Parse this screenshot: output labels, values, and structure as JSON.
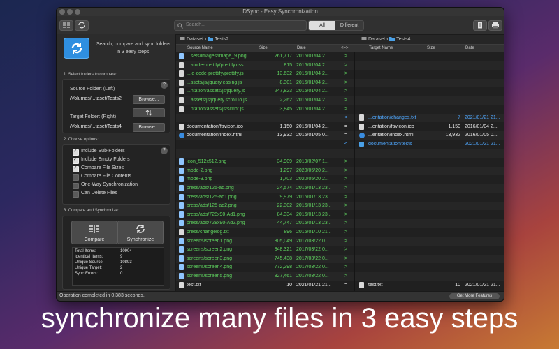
{
  "window": {
    "title": "DSync - Easy Synchronization"
  },
  "toolbar": {
    "search_placeholder": "Search...",
    "filter_options": [
      "All",
      "Different"
    ],
    "filter_selected": "All"
  },
  "left_panel": {
    "tagline": "Search, compare and sync folders in 3 easy steps:",
    "step1": {
      "title": "1. Select folders to compare:",
      "source_label": "Source Folder: (Left)",
      "source_path": "/Volumes/...taset/Tests2",
      "browse_label": "Browse...",
      "target_label": "Target Folder: (Right)",
      "target_path": "/Volumes/...taset/Tests4"
    },
    "step2": {
      "title": "2. Choose options:",
      "options": [
        {
          "label": "Include Sub-Folders",
          "checked": true
        },
        {
          "label": "Include Empty Folders",
          "checked": true
        },
        {
          "label": "Compare File Sizes",
          "checked": true
        },
        {
          "label": "Compare File Contents",
          "checked": false
        },
        {
          "label": "One-Way Synchronization",
          "checked": false
        },
        {
          "label": "Can Delete Files",
          "checked": false
        }
      ]
    },
    "step3": {
      "title": "3. Compare and Synchronize:",
      "compare_label": "Compare",
      "sync_label": "Synchronize",
      "stats": [
        {
          "label": "Total Items:",
          "value": "10904"
        },
        {
          "label": "Identical Items:",
          "value": "9"
        },
        {
          "label": "Unique Source:",
          "value": "10893"
        },
        {
          "label": "Unique Target:",
          "value": "2"
        },
        {
          "label": "Sync Errors:",
          "value": "0"
        }
      ]
    }
  },
  "left_path": {
    "root": "Dataset",
    "folder": "Tests2"
  },
  "right_path": {
    "root": "Dataset",
    "folder": "Tests4"
  },
  "columns": {
    "left": [
      "Source Name",
      "Size",
      "Date"
    ],
    "mid": "<=>",
    "right": [
      "Target Name",
      "Size",
      "Date"
    ]
  },
  "rows": [
    {
      "l_name": "...sets/images/image_9.png",
      "l_size": "261,717",
      "l_date": "2016/01/04 2...",
      "l_icon": "img",
      "op": ">",
      "color": "green"
    },
    {
      "l_name": "...-code-prettify/prettify.css",
      "l_size": "815",
      "l_date": "2016/01/04 2...",
      "l_icon": "file",
      "op": ">",
      "color": "green"
    },
    {
      "l_name": "...le-code-prettify/prettify.js",
      "l_size": "13,632",
      "l_date": "2016/01/04 2...",
      "l_icon": "file",
      "op": ">",
      "color": "green"
    },
    {
      "l_name": "...ssets/js/jquery.easing.js",
      "l_size": "8,301",
      "l_date": "2016/01/04 2...",
      "l_icon": "file",
      "op": ">",
      "color": "green"
    },
    {
      "l_name": "...ntation/assets/js/jquery.js",
      "l_size": "247,823",
      "l_date": "2016/01/04 2...",
      "l_icon": "file",
      "op": ">",
      "color": "green"
    },
    {
      "l_name": "...assets/js/jquery.scrollTo.js",
      "l_size": "2,262",
      "l_date": "2016/01/04 2...",
      "l_icon": "file",
      "op": ">",
      "color": "green"
    },
    {
      "l_name": "...ntation/assets/js/script.js",
      "l_size": "3,845",
      "l_date": "2016/01/04 2...",
      "l_icon": "file",
      "op": ">",
      "color": "green"
    },
    {
      "op": "<",
      "r_name": "...entation/changes.txt",
      "r_size": "7",
      "r_date": "2021/01/21 21...",
      "r_icon": "file",
      "color": "blue"
    },
    {
      "l_name": "documentation/favicon.ico",
      "l_size": "1,150",
      "l_date": "2016/01/04 2...",
      "l_icon": "file",
      "op": "=",
      "r_name": "...entation/favicon.ico",
      "r_size": "1,150",
      "r_date": "2016/01/04 2...",
      "r_icon": "file",
      "color": "white"
    },
    {
      "l_name": "documentation/index.html",
      "l_size": "13,932",
      "l_date": "2016/01/05 0...",
      "l_icon": "web",
      "op": "=",
      "r_name": "...entation/index.html",
      "r_size": "13,932",
      "r_date": "2016/01/05 0...",
      "r_icon": "web",
      "color": "white"
    },
    {
      "op": "<",
      "r_name": "documentation/tests",
      "r_size": "",
      "r_date": "2021/01/21 21...",
      "r_icon": "folder",
      "color": "blue"
    },
    {
      "op": "",
      "color": "white"
    },
    {
      "l_name": "icon_512x512.png",
      "l_size": "34,909",
      "l_date": "2019/02/07 1...",
      "l_icon": "img",
      "op": ">",
      "color": "green"
    },
    {
      "l_name": "mode-2.png",
      "l_size": "1,297",
      "l_date": "2020/05/20 2...",
      "l_icon": "img",
      "op": ">",
      "color": "green"
    },
    {
      "l_name": "mode-3.png",
      "l_size": "1,703",
      "l_date": "2020/05/20 2...",
      "l_icon": "img",
      "op": ">",
      "color": "green"
    },
    {
      "l_name": "press/ads/125-ad.png",
      "l_size": "24,574",
      "l_date": "2016/01/13 23...",
      "l_icon": "img",
      "op": ">",
      "color": "green"
    },
    {
      "l_name": "press/ads/125-ad1.png",
      "l_size": "9,979",
      "l_date": "2016/01/13 23...",
      "l_icon": "img",
      "op": ">",
      "color": "green"
    },
    {
      "l_name": "press/ads/125-ad2.png",
      "l_size": "22,302",
      "l_date": "2016/01/13 23...",
      "l_icon": "img",
      "op": ">",
      "color": "green"
    },
    {
      "l_name": "press/ads/728x90-Ad1.png",
      "l_size": "84,334",
      "l_date": "2016/01/13 23...",
      "l_icon": "img",
      "op": ">",
      "color": "green"
    },
    {
      "l_name": "press/ads/728x90-Ad2.png",
      "l_size": "44,747",
      "l_date": "2016/01/13 23...",
      "l_icon": "img",
      "op": ">",
      "color": "green"
    },
    {
      "l_name": "press/changelog.txt",
      "l_size": "896",
      "l_date": "2016/01/10 21...",
      "l_icon": "file",
      "op": ">",
      "color": "green"
    },
    {
      "l_name": "screens/screen1.png",
      "l_size": "805,049",
      "l_date": "2017/03/22 0...",
      "l_icon": "img",
      "op": ">",
      "color": "green"
    },
    {
      "l_name": "screens/screen2.png",
      "l_size": "848,321",
      "l_date": "2017/03/22 0...",
      "l_icon": "img",
      "op": ">",
      "color": "green"
    },
    {
      "l_name": "screens/screen3.png",
      "l_size": "745,438",
      "l_date": "2017/03/22 0...",
      "l_icon": "img",
      "op": ">",
      "color": "green"
    },
    {
      "l_name": "screens/screen4.png",
      "l_size": "772,298",
      "l_date": "2017/03/22 0...",
      "l_icon": "img",
      "op": ">",
      "color": "green"
    },
    {
      "l_name": "screens/screen5.png",
      "l_size": "827,461",
      "l_date": "2017/03/22 0...",
      "l_icon": "img",
      "op": ">",
      "color": "green"
    },
    {
      "l_name": "test.txt",
      "l_size": "10",
      "l_date": "2021/01/21 21...",
      "l_icon": "file",
      "op": "=",
      "r_name": "test.txt",
      "r_size": "10",
      "r_date": "2021/01/21 21...",
      "r_icon": "file",
      "color": "white"
    }
  ],
  "status": {
    "text": "Operation completed in 0.383 seconds.",
    "more_features_label": "Get More Features"
  },
  "caption": "synchronize many files in 3 easy steps",
  "colors": {
    "new_in_source": "#5fd35f",
    "new_in_target": "#4fa8ff",
    "identical": "#e8e8e8"
  }
}
